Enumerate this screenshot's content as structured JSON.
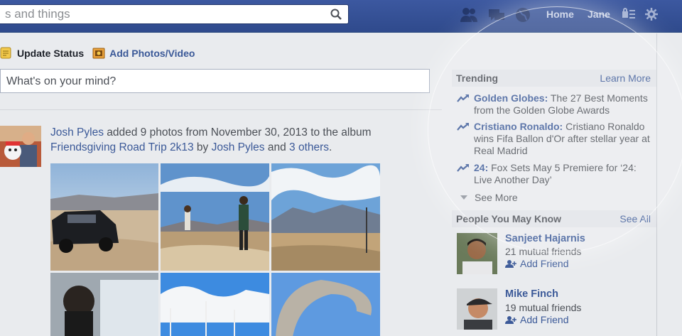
{
  "search": {
    "value": "s and things"
  },
  "header": {
    "home_label": "Home",
    "profile_label": "Jane"
  },
  "composer": {
    "update_status_label": "Update Status",
    "add_photos_label": "Add Photos/Video",
    "placeholder": "What's on your mind?"
  },
  "story": {
    "author": "Josh Pyles",
    "text_1": " added 9 photos from November 30, 2013 to the album ",
    "album": "Friendsgiving Road Trip 2k13",
    "text_2": " by ",
    "author2": "Josh Pyles",
    "text_3": " and ",
    "others": "3 others",
    "text_4": "."
  },
  "trending": {
    "title": "Trending",
    "learn_more": "Learn More",
    "items": [
      {
        "topic": "Golden Globes:",
        "desc": " The 27 Best Moments from the Golden Globe Awards"
      },
      {
        "topic": "Cristiano Ronaldo:",
        "desc": " Cristiano Ronaldo wins Fifa Ballon d'Or after stellar year at Real Madrid"
      },
      {
        "topic": "24:",
        "desc": " Fox Sets May 5 Premiere for ‘24: Live Another Day’"
      }
    ],
    "see_more": "See More"
  },
  "pymk": {
    "title": "People You May Know",
    "see_all": "See All",
    "people": [
      {
        "name": "Sanjeet Hajarnis",
        "mutual": "21 mutual friends",
        "add": "Add Friend"
      },
      {
        "name": "Mike Finch",
        "mutual": "19 mutual friends",
        "add": "Add Friend"
      }
    ]
  },
  "colors": {
    "brand": "#3b5998",
    "topbar": "#3c58a0",
    "background": "#e9ebee"
  },
  "icons": [
    "search-icon",
    "friends-icon",
    "messages-icon",
    "globe-icon",
    "privacy-icon",
    "gear-icon",
    "status-icon",
    "photo-icon",
    "trending-arrow-icon",
    "add-friend-icon"
  ]
}
